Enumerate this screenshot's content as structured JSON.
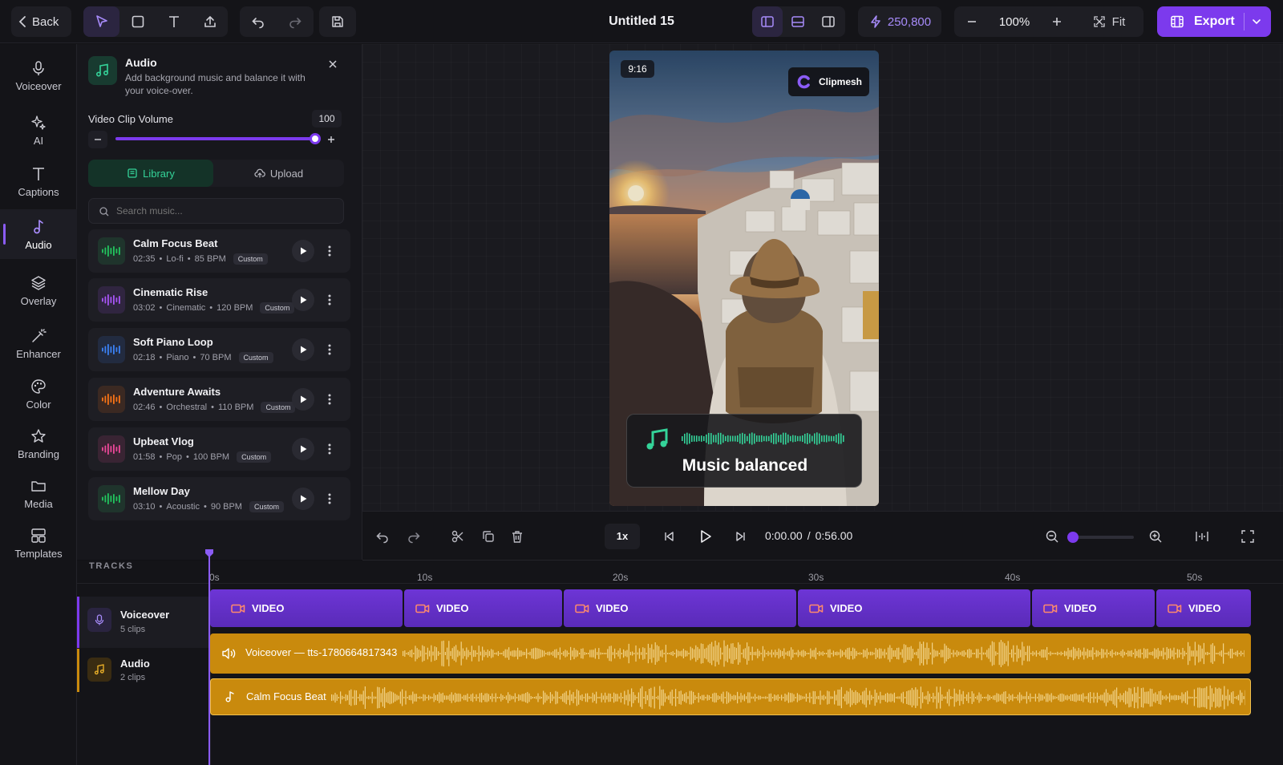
{
  "toolbar": {
    "back_label": "Back",
    "title": "Untitled 15",
    "credits": "250,800",
    "zoom": "100%",
    "fit_label": "Fit",
    "export_label": "Export"
  },
  "rail": {
    "items": [
      {
        "label": "Voiceover",
        "icon": "mic-icon"
      },
      {
        "label": "AI",
        "icon": "sparkles-icon"
      },
      {
        "label": "Captions",
        "icon": "text-icon"
      },
      {
        "label": "Audio",
        "icon": "music-note-icon"
      },
      {
        "label": "Overlay",
        "icon": "layers-icon"
      },
      {
        "label": "Enhancer",
        "icon": "magic-wand-icon"
      },
      {
        "label": "Color",
        "icon": "palette-icon"
      },
      {
        "label": "Branding",
        "icon": "star-icon"
      },
      {
        "label": "Media",
        "icon": "folder-icon"
      },
      {
        "label": "Templates",
        "icon": "templates-icon"
      }
    ],
    "active": "Audio"
  },
  "panel": {
    "title": "Audio",
    "subtitle_line1": "Add background music and balance it with",
    "subtitle_line2": "your voice-over.",
    "volume_label": "Video Clip Volume",
    "volume_value": "100",
    "volume_fraction": 1.0,
    "tab_library": "Library",
    "tab_upload": "Upload",
    "search_placeholder": "Search music...",
    "tracks": [
      {
        "name": "Calm Focus Beat",
        "duration": "02:35",
        "genre": "Lo-fi",
        "bpm": "85 BPM",
        "badge": "Custom",
        "color": "#22c55e"
      },
      {
        "name": "Cinematic Rise",
        "duration": "03:02",
        "genre": "Cinematic",
        "bpm": "120 BPM",
        "badge": "Custom",
        "color": "#a855f7"
      },
      {
        "name": "Soft Piano Loop",
        "duration": "02:18",
        "genre": "Piano",
        "bpm": "70 BPM",
        "badge": "Custom",
        "color": "#3b82f6"
      },
      {
        "name": "Adventure Awaits",
        "duration": "02:46",
        "genre": "Orchestral",
        "bpm": "110 BPM",
        "badge": "Custom",
        "color": "#f97316"
      },
      {
        "name": "Upbeat Vlog",
        "duration": "01:58",
        "genre": "Pop",
        "bpm": "100 BPM",
        "badge": "Custom",
        "color": "#ec4899"
      },
      {
        "name": "Mellow Day",
        "duration": "03:10",
        "genre": "Acoustic",
        "bpm": "90 BPM",
        "badge": "Custom",
        "color": "#22c55e"
      }
    ]
  },
  "preview": {
    "aspect_label": "9:16",
    "brand_name": "Clipmesh",
    "overlay_text": "Music balanced"
  },
  "playback": {
    "speed": "1x",
    "current_time": "0:00.00",
    "separator": "/",
    "total_time": "0:56.00",
    "zoom_fraction": 0.0
  },
  "timeline": {
    "header": "TRACKS",
    "ticks": [
      "0s",
      "10s",
      "20s",
      "30s",
      "40s",
      "50s"
    ],
    "tracks": [
      {
        "name": "Voiceover",
        "sub": "5 clips"
      },
      {
        "name": "Audio",
        "sub": "2 clips"
      }
    ],
    "video_clips": [
      "VIDEO",
      "VIDEO",
      "VIDEO",
      "VIDEO",
      "VIDEO",
      "VIDEO"
    ],
    "voiceover_clip": "Voiceover — tts-1780664817343",
    "music_clip": "Calm Focus Beat"
  },
  "colors": {
    "accent": "#7c3aed",
    "music_green": "#34d399",
    "audio_clip": "#c98a0d"
  }
}
